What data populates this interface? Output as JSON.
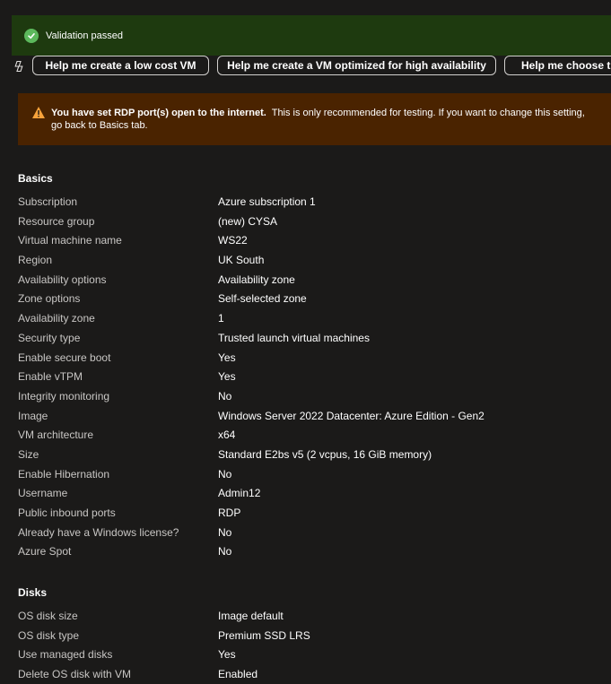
{
  "validation": {
    "text": "Validation passed",
    "color": "#1e3a0f"
  },
  "suggestions": [
    {
      "label": "Help me create a low cost VM"
    },
    {
      "label": "Help me create a VM optimized for high availability"
    },
    {
      "label": "Help me choose th"
    }
  ],
  "warning": {
    "bold": "You have set RDP port(s) open to the internet.",
    "text": "This is only recommended for testing.  If you want to change this setting, go back to Basics tab.",
    "color": "#4a2300"
  },
  "basics": {
    "heading": "Basics",
    "rows": [
      {
        "label": "Subscription",
        "value": "Azure subscription 1"
      },
      {
        "label": "Resource group",
        "value": "(new) CYSA"
      },
      {
        "label": "Virtual machine name",
        "value": "WS22"
      },
      {
        "label": "Region",
        "value": "UK South"
      },
      {
        "label": "Availability options",
        "value": "Availability zone"
      },
      {
        "label": "Zone options",
        "value": "Self-selected zone"
      },
      {
        "label": "Availability zone",
        "value": "1"
      },
      {
        "label": "Security type",
        "value": "Trusted launch virtual machines"
      },
      {
        "label": "Enable secure boot",
        "value": "Yes"
      },
      {
        "label": "Enable vTPM",
        "value": "Yes"
      },
      {
        "label": "Integrity monitoring",
        "value": "No"
      },
      {
        "label": "Image",
        "value": "Windows Server 2022 Datacenter: Azure Edition - Gen2"
      },
      {
        "label": "VM architecture",
        "value": "x64"
      },
      {
        "label": "Size",
        "value": "Standard E2bs v5 (2 vcpus, 16 GiB memory)"
      },
      {
        "label": "Enable Hibernation",
        "value": "No"
      },
      {
        "label": "Username",
        "value": "Admin12"
      },
      {
        "label": "Public inbound ports",
        "value": "RDP"
      },
      {
        "label": "Already have a Windows license?",
        "value": "No"
      },
      {
        "label": "Azure Spot",
        "value": "No"
      }
    ]
  },
  "disks": {
    "heading": "Disks",
    "rows": [
      {
        "label": "OS disk size",
        "value": "Image default"
      },
      {
        "label": "OS disk type",
        "value": "Premium SSD LRS"
      },
      {
        "label": "Use managed disks",
        "value": "Yes"
      },
      {
        "label": "Delete OS disk with VM",
        "value": "Enabled"
      }
    ]
  }
}
